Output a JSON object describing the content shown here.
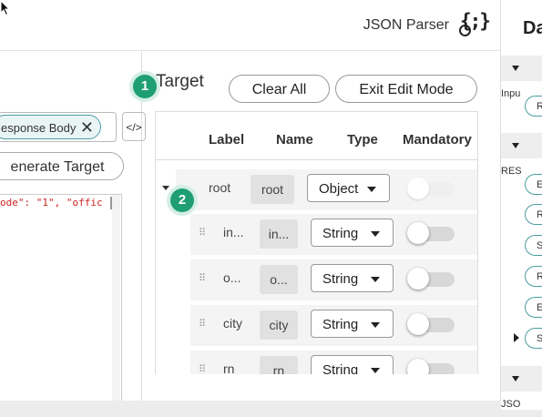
{
  "header": {
    "title": "JSON Parser",
    "icon": "json-parser-icon"
  },
  "left_panel": {
    "chip_label": "esponse Body",
    "chip_close": "✕",
    "small_button_icon": "code-edit-icon",
    "small_button_text": "</>",
    "generate_button": "enerate Target",
    "code_line_1": "ode\": \"1\", \"offic"
  },
  "target": {
    "title": "Target",
    "badge_1": "1",
    "badge_2": "2",
    "clear_all": "Clear All",
    "exit_edit": "Exit Edit Mode",
    "columns": [
      "Label",
      "Name",
      "Type",
      "Mandatory"
    ],
    "rows": [
      {
        "label": "root",
        "name": "root",
        "type": "Object",
        "mandatory_enabled": false
      },
      {
        "label": "in...",
        "name": "in...",
        "type": "String",
        "mandatory_enabled": true
      },
      {
        "label": "o...",
        "name": "o...",
        "type": "String",
        "mandatory_enabled": true
      },
      {
        "label": "city",
        "name": "city",
        "type": "String",
        "mandatory_enabled": true
      },
      {
        "label": "rn",
        "name": "rn",
        "type": "String",
        "mandatory_enabled": true
      }
    ]
  },
  "right_panel": {
    "title": "Da",
    "sections": [
      {
        "label": "Inpu"
      },
      {
        "label": "RES"
      },
      {
        "label": "JSO"
      }
    ],
    "pills": [
      "R",
      "E",
      "R",
      "S",
      "R",
      "E",
      "S"
    ]
  }
}
